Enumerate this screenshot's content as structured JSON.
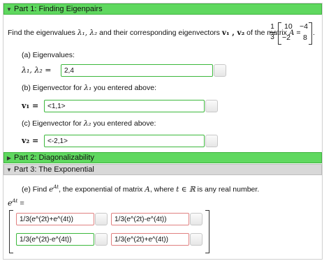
{
  "part1": {
    "label": "Part 1: Finding Eigenpairs"
  },
  "problem": {
    "text_before": "Find the eigenvalues ",
    "lambdas": "λ₁, λ₂",
    "text_mid": " and their corresponding eigenvectors ",
    "vectors": "v₁ , v₂",
    "text_after": " of the matrix ",
    "matrix_name": "A",
    "eq": "=",
    "frac_num": "1",
    "frac_den": "3",
    "matrix": [
      [
        "10",
        "−4"
      ],
      [
        "−2",
        "8"
      ]
    ],
    "period": "."
  },
  "qa": {
    "label": "(a) Eigenvalues:",
    "lhs": "λ₁, λ₂ =",
    "value": "2,4"
  },
  "qb": {
    "label_pre": "(b) Eigenvector for ",
    "label_sym": "λ₁",
    "label_post": " you entered above:",
    "lhs": "v₁ =",
    "value": "<1,1>"
  },
  "qc": {
    "label_pre": "(c) Eigenvector for ",
    "label_sym": "λ₂",
    "label_post": " you entered above:",
    "lhs": "v₂ =",
    "value": "<-2,1>"
  },
  "part2": {
    "label": "Part 2: Diagonalizability"
  },
  "part3": {
    "label": "Part 3: The Exponential"
  },
  "qe": {
    "pre": "(e) Find ",
    "sym": "e",
    "sup": "At",
    "mid": ", the exponential of matrix ",
    "A": "A",
    "mid2": ", where ",
    "cond": "t ∈ ℝ",
    "post": " is any real number.",
    "lhs": "e",
    "lhs_sup": "At",
    "lhs_eq": "="
  },
  "exp_matrix": [
    [
      "1/3(e^(2t)+e^(4t))",
      "1/3(e^(2t)-e^(4t))"
    ],
    [
      "1/3(e^(2t)-e^(4t))",
      "1/3(e^(2t)+e^(4t))"
    ]
  ],
  "colors": {
    "green": "#5fd85f",
    "ok": "#3cb83c",
    "bad": "#e08080"
  }
}
